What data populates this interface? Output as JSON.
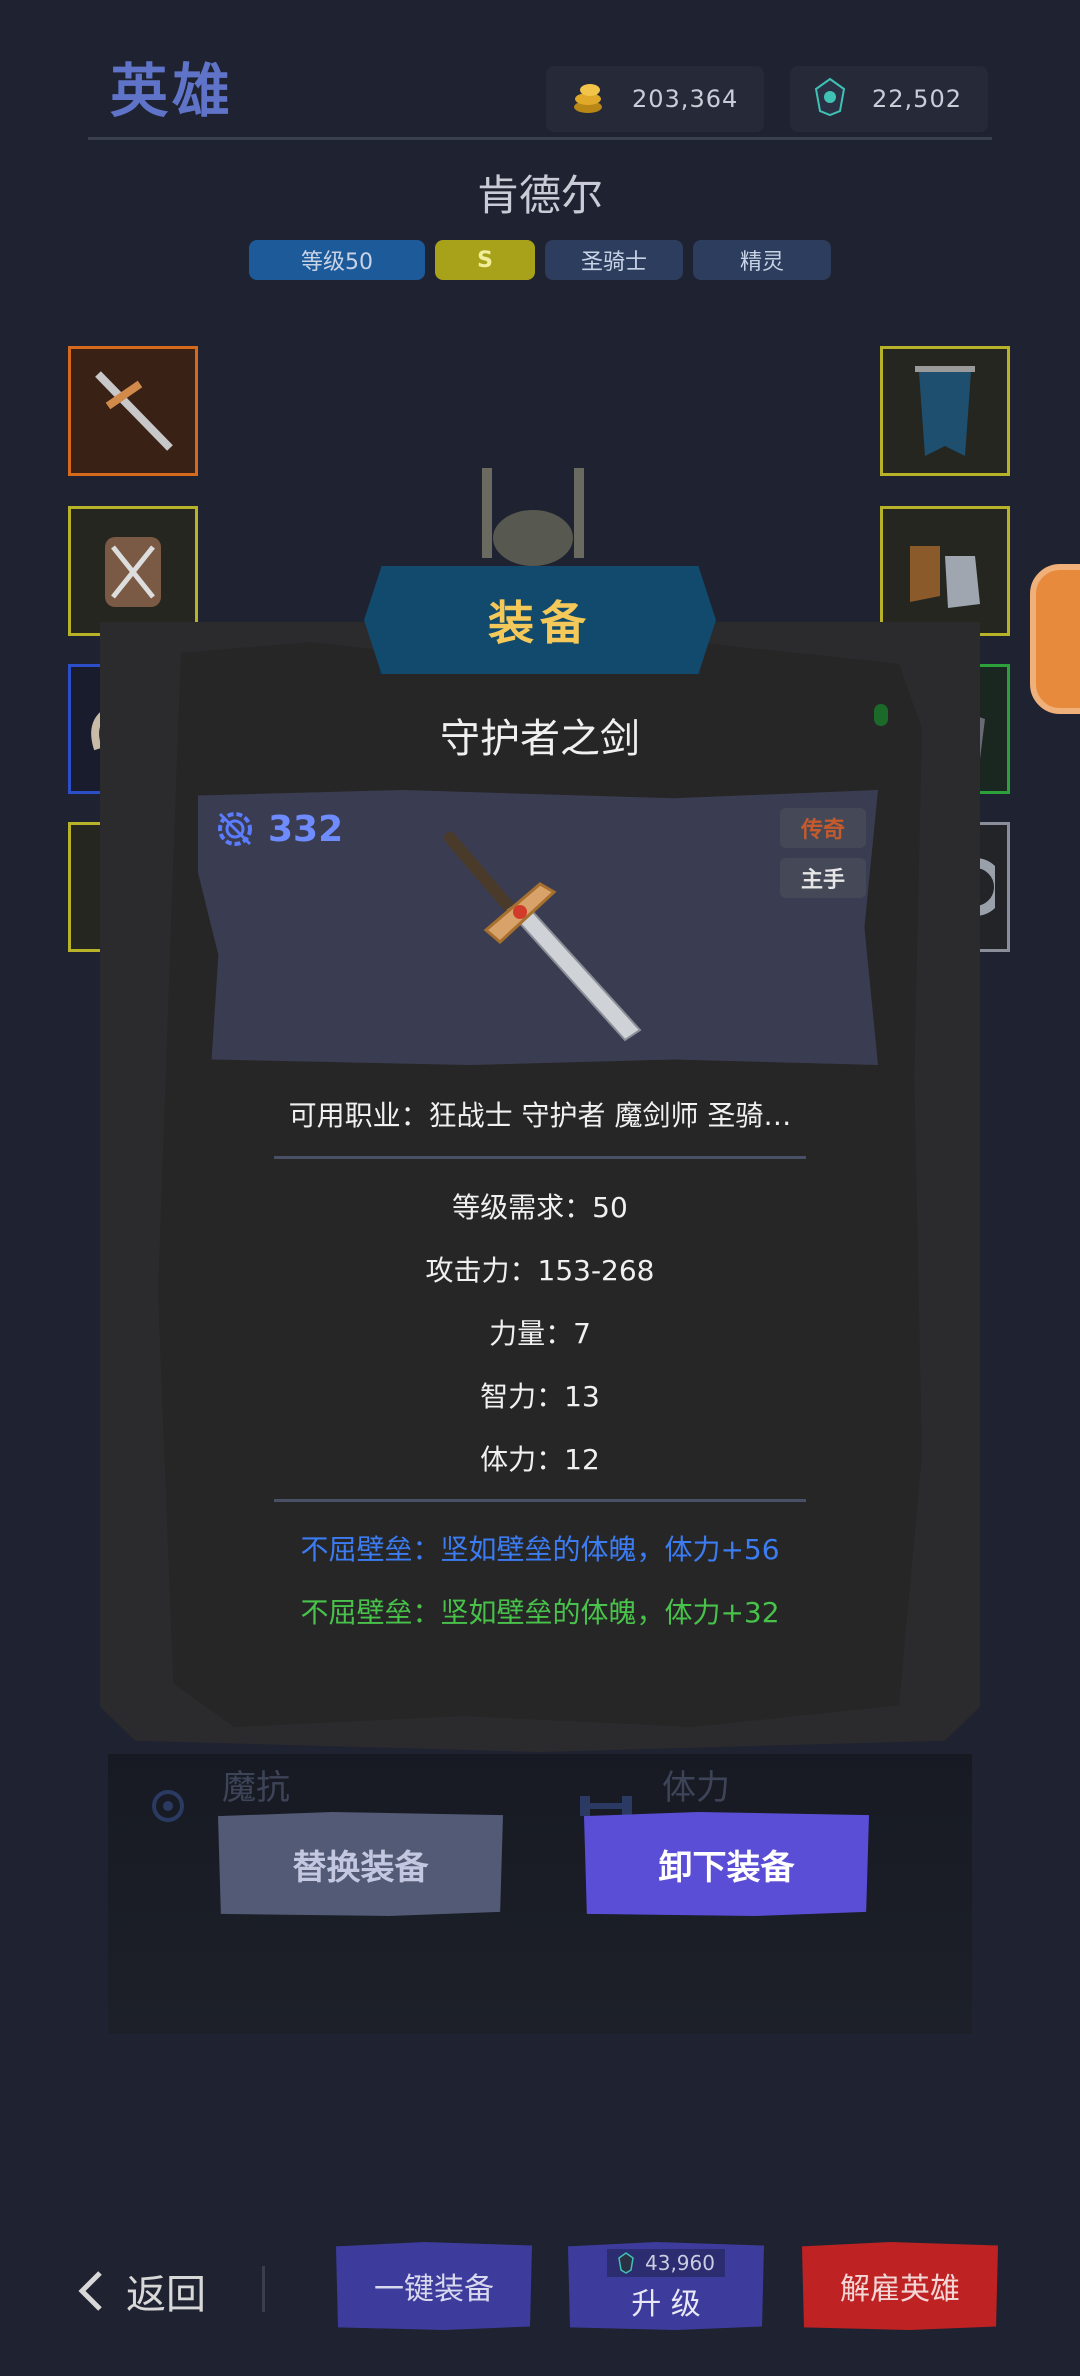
{
  "header": {
    "title": "英雄",
    "currencies": [
      {
        "icon": "gold-coins-icon",
        "value": "203,364"
      },
      {
        "icon": "crystal-gem-icon",
        "value": "22,502"
      }
    ]
  },
  "hero": {
    "name": "肯德尔",
    "tags": {
      "level": "等级50",
      "rank": "S",
      "class": "圣骑士",
      "race": "精灵"
    }
  },
  "background": {
    "stat_left": "魔抗",
    "stat_right": "体力"
  },
  "modal": {
    "title": "装备",
    "item": {
      "name": "守护者之剑",
      "power": "332",
      "rarity": "传奇",
      "slot": "主手",
      "classes": "可用职业：狂战士 守护者 魔剑师 圣骑…",
      "stats": [
        "等级需求：50",
        "攻击力：153-268",
        "力量：7",
        "智力：13",
        "体力：12"
      ],
      "set_bonuses": [
        {
          "text": "不屈壁垒：坚如壁垒的体魄，体力+56",
          "color": "#3c7cf2"
        },
        {
          "text": "不屈壁垒：坚如壁垒的体魄，体力+32",
          "color": "#48c24a"
        }
      ]
    },
    "buttons": {
      "replace": "替换装备",
      "unequip": "卸下装备"
    }
  },
  "bottombar": {
    "back": "返回",
    "auto_equip": "一键装备",
    "upgrade_cost": "43,960",
    "upgrade": "升 级",
    "dismiss": "解雇英雄"
  }
}
